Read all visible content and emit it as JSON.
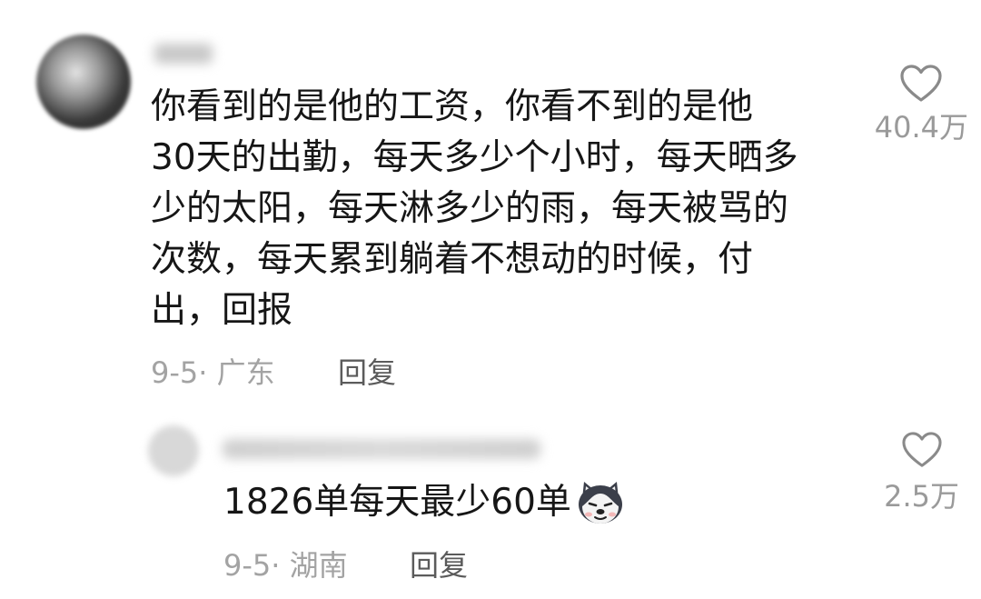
{
  "main_comment": {
    "text_lines": [
      "你看到的是他的工资，你看不到的是他",
      "30天的出勤，每天多少个小时，每天晒多",
      "少的太阳，每天淋多少的雨，每天被骂的",
      "次数，每天累到躺着不想动的时候，付",
      "出，回报"
    ],
    "date_location": "9-5· 广东",
    "reply_label": "回复",
    "like_count": "40.4万",
    "like_icon": "heart-outline-icon"
  },
  "reply_comment": {
    "text": "1826单每天最少60单",
    "emoji": "husky-dog-emoji",
    "date_location": "9-5· 湖南",
    "reply_label": "回复",
    "like_count": "2.5万",
    "like_icon": "heart-outline-icon"
  },
  "colors": {
    "text_primary": "#161616",
    "text_meta": "#a3a3a3",
    "reply_action": "#5b5b5b",
    "like_count": "#9a9a9a"
  }
}
